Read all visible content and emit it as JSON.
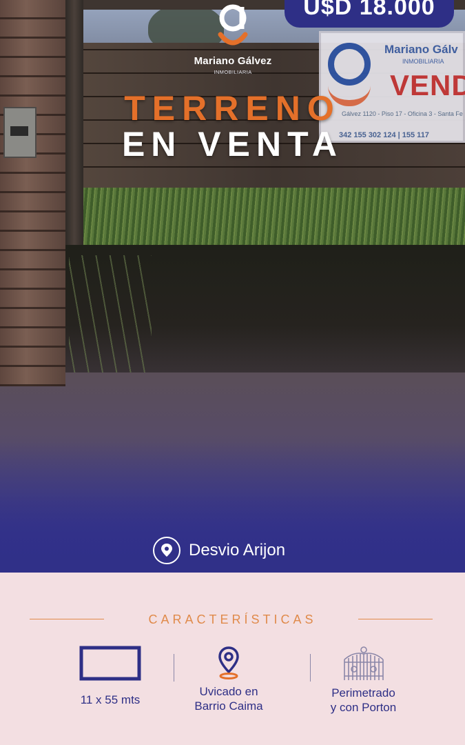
{
  "brand": {
    "name": "Mariano Gálvez",
    "tagline": "INMOBILIARIA",
    "accent_orange": "#e4702a",
    "accent_navy": "#2e2f86"
  },
  "price": "U$D 18.000",
  "title": {
    "line1": "TERRENO",
    "line2": "EN VENTA"
  },
  "photo_sign": {
    "name": "Mariano Gálv",
    "sub": "INMOBILIARIA",
    "word": "VEND",
    "info": "Gálvez 1120 - Piso 17 - Oficina 3 - Santa Fe",
    "phone": "342 155 302 124 | 155 117"
  },
  "location": {
    "icon": "location-pin-icon",
    "text": "Desvio Arijon"
  },
  "features": {
    "section_title": "CARACTERÍSTICAS",
    "items": [
      {
        "icon": "rectangle-lot-icon",
        "label_line1": "11 x 55 mts",
        "label_line2": ""
      },
      {
        "icon": "location-pin-icon",
        "label_line1": "Uvicado en",
        "label_line2": "Barrio Caima"
      },
      {
        "icon": "gate-icon",
        "label_line1": "Perimetrado",
        "label_line2": "y con Porton"
      }
    ]
  }
}
